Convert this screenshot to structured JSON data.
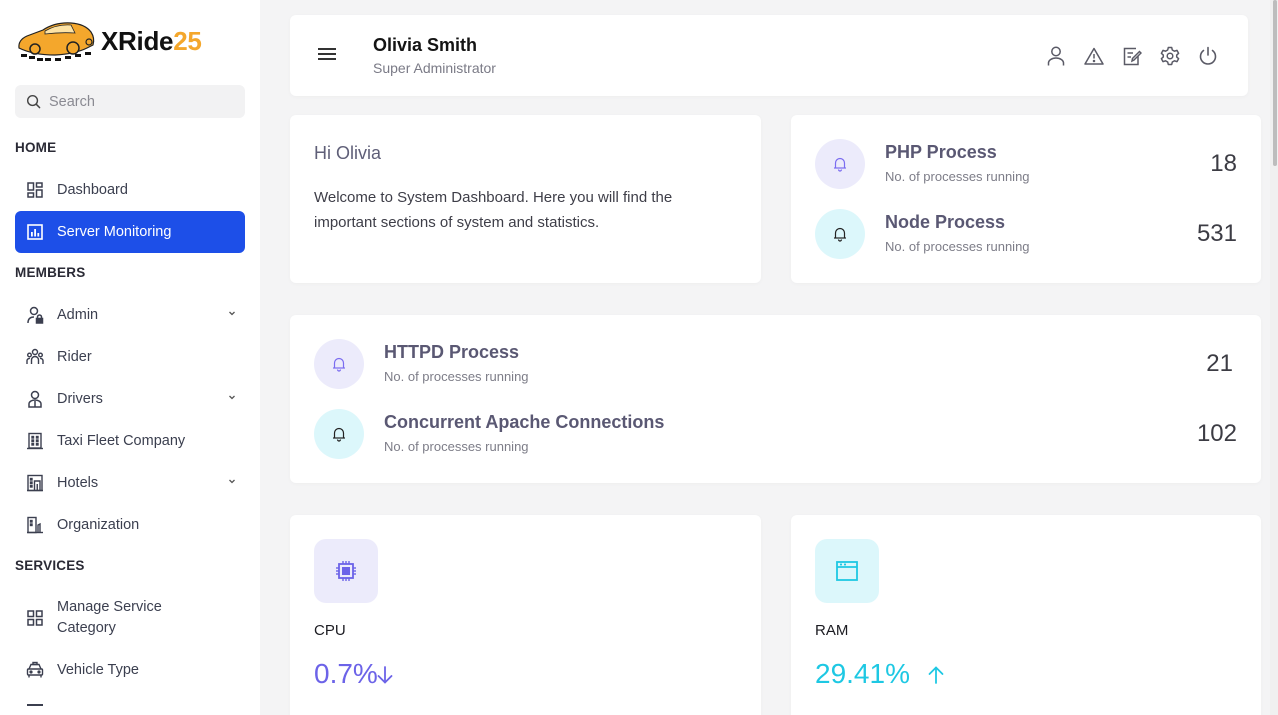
{
  "brand": {
    "name_main": "XRide",
    "name_accent": "25",
    "accent_color": "#f4a72c"
  },
  "sidebar": {
    "search_placeholder": "Search",
    "sections": [
      {
        "title": "HOME",
        "items": [
          {
            "label": "Dashboard",
            "icon": "dashboard-grid-icon",
            "active": false,
            "has_submenu": false
          },
          {
            "label": "Server Monitoring",
            "icon": "chart-bar-icon",
            "active": true,
            "has_submenu": false
          }
        ]
      },
      {
        "title": "MEMBERS",
        "items": [
          {
            "label": "Admin",
            "icon": "user-lock-icon",
            "active": false,
            "has_submenu": true
          },
          {
            "label": "Rider",
            "icon": "users-group-icon",
            "active": false,
            "has_submenu": false
          },
          {
            "label": "Drivers",
            "icon": "driver-icon",
            "active": false,
            "has_submenu": true
          },
          {
            "label": "Taxi Fleet Company",
            "icon": "building-icon",
            "active": false,
            "has_submenu": false
          },
          {
            "label": "Hotels",
            "icon": "hotel-icon",
            "active": false,
            "has_submenu": true
          },
          {
            "label": "Organization",
            "icon": "organization-icon",
            "active": false,
            "has_submenu": false
          }
        ]
      },
      {
        "title": "SERVICES",
        "items": [
          {
            "label": "Manage Service Category",
            "icon": "category-grid-icon",
            "active": false,
            "has_submenu": false
          },
          {
            "label": "Vehicle Type",
            "icon": "taxi-icon",
            "active": false,
            "has_submenu": false
          }
        ]
      }
    ],
    "active_color": "#1d4fe8"
  },
  "header": {
    "user_name": "Olivia Smith",
    "user_role": "Super Administrator",
    "icons": [
      "profile-icon",
      "alert-icon",
      "edit-icon",
      "settings-icon",
      "power-icon"
    ]
  },
  "welcome": {
    "greeting": "Hi Olivia",
    "message": "Welcome to System Dashboard. Here you will find the important sections of system and statistics."
  },
  "processes": [
    {
      "title": "PHP Process",
      "subtitle": "No. of processes running",
      "value": "18",
      "theme": "purple"
    },
    {
      "title": "Node Process",
      "subtitle": "No. of processes running",
      "value": "531",
      "theme": "cyan"
    },
    {
      "title": "HTTPD Process",
      "subtitle": "No. of processes running",
      "value": "21",
      "theme": "purple"
    },
    {
      "title": "Concurrent Apache Connections",
      "subtitle": "No. of processes running",
      "value": "102",
      "theme": "cyan"
    }
  ],
  "stats": {
    "cpu": {
      "label": "CPU",
      "value": "0.7%",
      "trend": "down",
      "color": "#6c63e8"
    },
    "ram": {
      "label": "RAM",
      "value": "29.41%",
      "trend": "up",
      "color": "#1ec8e3"
    }
  }
}
